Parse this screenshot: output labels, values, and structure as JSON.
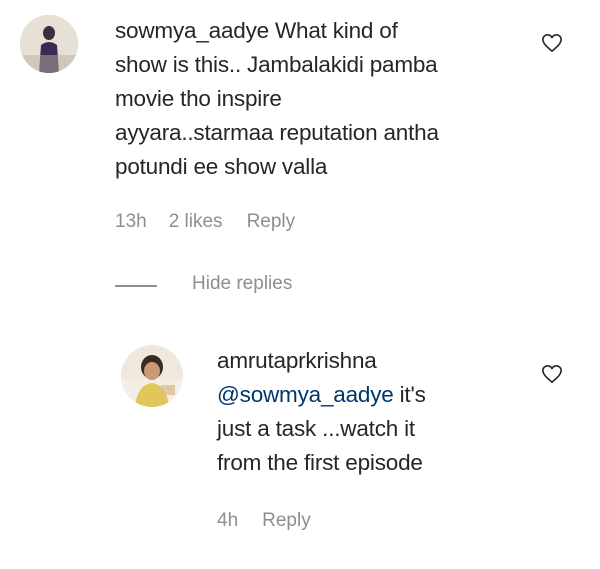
{
  "comment": {
    "username": "sowmya_aadye",
    "text_line1": " What kind of",
    "text_line2": "show is this.. Jambalakidi pamba",
    "text_line3": "movie tho inspire",
    "text_line4": "ayyara..starmaa reputation antha",
    "text_line5": "potundi ee show valla",
    "time": "13h",
    "likes": "2 likes",
    "reply_label": "Reply"
  },
  "replies_toggle": {
    "label": "Hide replies"
  },
  "reply": {
    "username": "amrutaprkrishna",
    "mention": "@sowmya_aadye",
    "text_line1": " it's",
    "text_line2": "just a task ...watch it",
    "text_line3": "from the first episode",
    "time": "4h",
    "reply_label": "Reply"
  },
  "icons": {
    "like": "heart-icon"
  },
  "colors": {
    "text": "#262626",
    "meta": "#8e8e8e",
    "mention": "#00376b"
  }
}
